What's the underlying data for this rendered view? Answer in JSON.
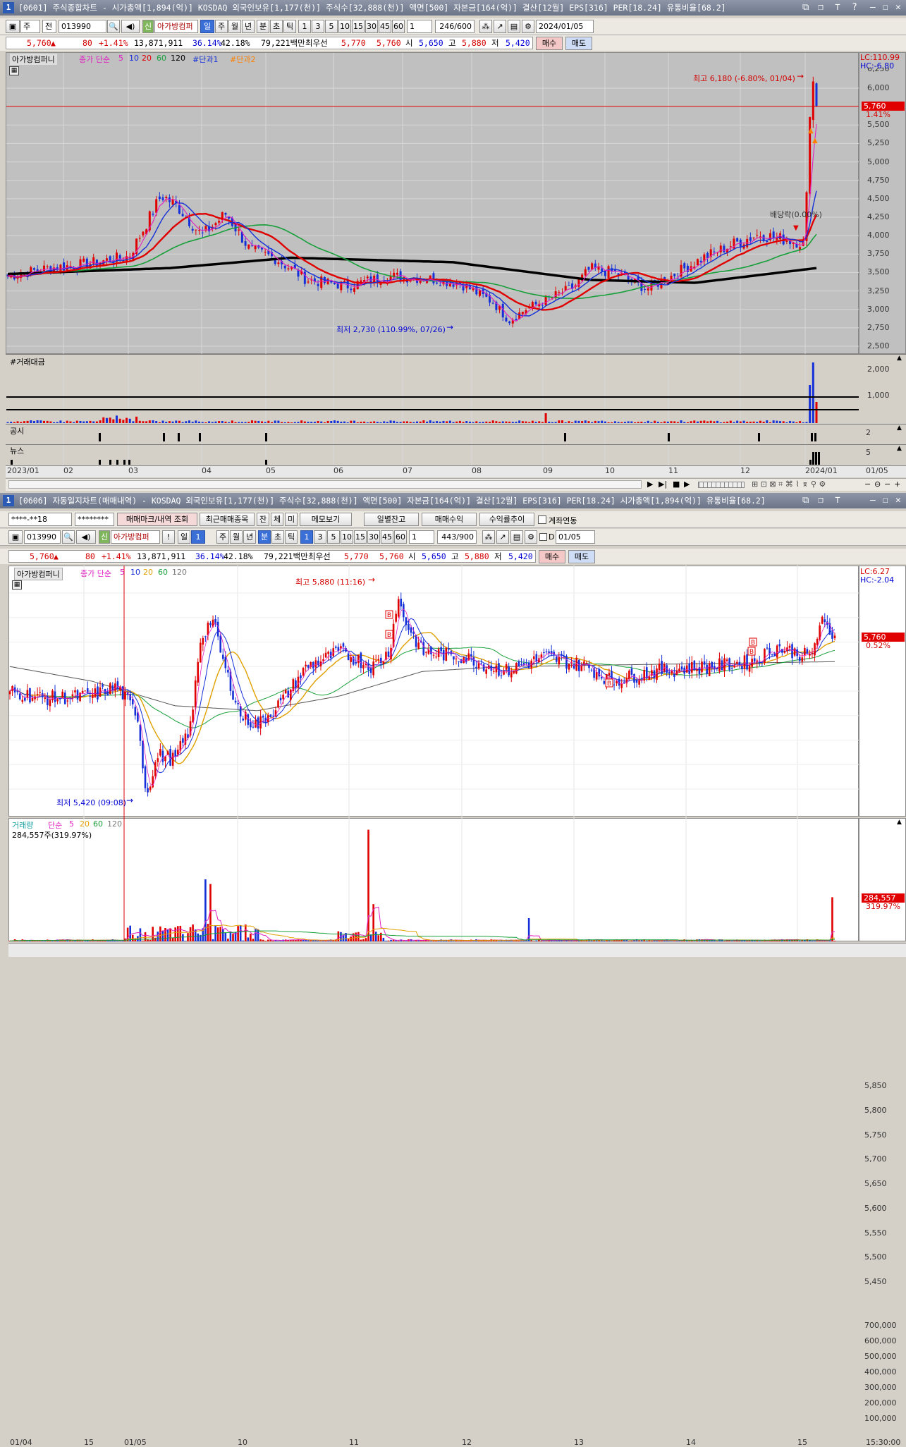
{
  "top": {
    "win_num": "1",
    "title": "[0601] 주식종합차트 - 시가총액[1,894(억)] KOSDAQ 외국인보유[1,177(천)] 주식수[32,888(천)] 액면[500] 자본금[164(억)] 결산[12월] EPS[316] PER[18.24] 유통비율[68.2]",
    "toolbar": {
      "type1": "주",
      "type2": "전",
      "code": "013990",
      "new_badge": "신",
      "name": "아가방컴퍼",
      "periods": [
        "일",
        "주",
        "월",
        "년",
        "분",
        "초",
        "틱"
      ],
      "mins": [
        "1",
        "3",
        "5",
        "10",
        "15",
        "30",
        "45",
        "60"
      ],
      "count_sel": "1",
      "count": "246/600",
      "date": "2024/01/05"
    },
    "quote": {
      "price": "5,760",
      "arrow": "▲",
      "change": "80",
      "rate": "+1.41%",
      "volume": "13,871,911",
      "p1": "36.14%",
      "p2": "42.18%",
      "amount": "79,221백만",
      "best_label": "최우선",
      "ask": "5,770",
      "bid": "5,760",
      "open_label": "시",
      "open": "5,650",
      "high_label": "고",
      "high": "5,880",
      "low_label": "저",
      "low": "5,420",
      "buy": "매수",
      "sell": "매도"
    },
    "legend": {
      "name": "아가방컴퍼니",
      "ma_label": "종가 단순",
      "mas": [
        "5",
        "10",
        "20",
        "60",
        "120"
      ],
      "extra1": "#단과1",
      "extra2": "#단과2"
    },
    "lc": "LC:110.99",
    "hc": "HC:-6.80",
    "price_axis": [
      "6,000",
      "5,750",
      "5,500",
      "5,250",
      "5,000",
      "4,750",
      "4,500",
      "4,250",
      "4,000",
      "3,750",
      "3,500",
      "3,250",
      "3,000",
      "2,750",
      "2,500"
    ],
    "axis_top_cut": "6,250",
    "cur_tag": "5,760",
    "cur_rate": "1.41%",
    "max_note": "최고 6,180 (-6.80%, 01/04)",
    "min_note": "최저 2,730 (110.99%, 07/26)",
    "div_note": "배당락(0.00%)",
    "amt_title": "#거래대금",
    "amt_axis": [
      "2,000",
      "1,000"
    ],
    "notice": "공시",
    "notice_axis": "2",
    "news": "뉴스",
    "news_axis": "5",
    "dates": [
      "2023/01",
      "02",
      "03",
      "04",
      "05",
      "06",
      "07",
      "08",
      "09",
      "10",
      "11",
      "12",
      "2024/01",
      "01/05"
    ]
  },
  "bottom": {
    "win_num": "1",
    "title": "[0606] 자동일지차트(매매내역) - KOSDAQ 외국인보유[1,177(천)] 주식수[32,888(천)] 액면[500] 자본금[164(억)] 결산[12월] EPS[316] PER[18.24] 시가총액[1,894(억)] 유통비율[68.2]",
    "row1": {
      "account": "****-**18",
      "password": "********",
      "btn1": "매매마크/내역 조회",
      "btn2": "최근매매종목",
      "b_jan": "잔",
      "b_che": "체",
      "b_mi": "미",
      "memo": "메모보기",
      "daily": "일별잔고",
      "profit": "매매수익",
      "trend": "수익률추이",
      "link": "계좌연동"
    },
    "row2": {
      "code": "013990",
      "new_badge": "신",
      "name": "아가방컴퍼",
      "excl": "!",
      "day": "일",
      "day_n": "1",
      "periods": [
        "주",
        "월",
        "년",
        "분",
        "초",
        "틱"
      ],
      "mins": [
        "1",
        "3",
        "5",
        "10",
        "15",
        "30",
        "45",
        "60"
      ],
      "count_sel": "1",
      "count": "443/900",
      "d": "D",
      "date": "01/05"
    },
    "legend": {
      "name": "아가방컴퍼니",
      "ma_label": "종가 단순",
      "mas": [
        "5",
        "10",
        "20",
        "60",
        "120"
      ]
    },
    "lc": "LC:6.27",
    "hc": "HC:-2.04",
    "price_axis": [
      "5,850",
      "5,800",
      "5,750",
      "5,700",
      "5,650",
      "5,600",
      "5,550",
      "5,500",
      "5,450"
    ],
    "cur_tag": "5,760",
    "cur_rate": "0.52%",
    "max_note": "최고 5,880 (11:16)",
    "min_note": "최저 5,420 (09:08)",
    "vol_legend": {
      "name": "거래량",
      "label": "단순",
      "mas": [
        "5",
        "20",
        "60",
        "120"
      ]
    },
    "vol_value": "284,557주(319.97%)",
    "vol_axis": [
      "700,000",
      "600,000",
      "500,000",
      "400,000",
      "300,000",
      "200,000",
      "100,000"
    ],
    "vol_tag": "284,557",
    "vol_rate": "319.97%",
    "times": [
      "01/04",
      "15",
      "01/05",
      "10",
      "11",
      "12",
      "13",
      "14",
      "15",
      "15:30:00"
    ],
    "mark": "B"
  }
}
